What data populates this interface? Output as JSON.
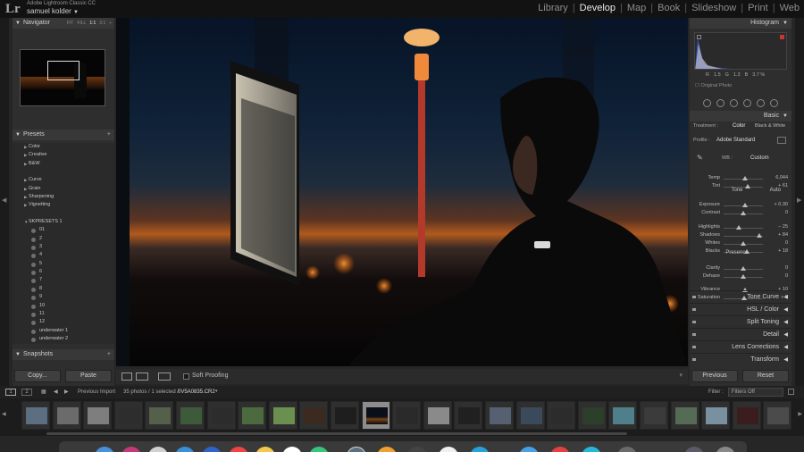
{
  "app": {
    "logo": "Lr",
    "name": "Adobe Lightroom Classic CC",
    "user": "samuel kolder",
    "user_caret": "▼"
  },
  "modules": [
    "Library",
    "Develop",
    "Map",
    "Book",
    "Slideshow",
    "Print",
    "Web"
  ],
  "active_module": "Develop",
  "navigator": {
    "title": "Navigator",
    "options": [
      "FIT",
      "FILL",
      "1:1",
      "3:1"
    ],
    "selected": "1:1",
    "more": "÷"
  },
  "presets": {
    "title": "Presets",
    "groups": [
      "Color",
      "Creative",
      "B&W",
      "Curve",
      "Grain",
      "Sharpening",
      "Vignetting"
    ],
    "user_group": "SKPRESETS 1",
    "user_items": [
      "01",
      "2",
      "3",
      "4",
      "5",
      "6",
      "7",
      "8",
      "9",
      "10",
      "11",
      "12",
      "underwater 1",
      "underwater 2"
    ]
  },
  "snapshots": {
    "title": "Snapshots"
  },
  "left_buttons": {
    "copy": "Copy...",
    "paste": "Paste"
  },
  "toolbar": {
    "soft_proofing": "Soft Proofing"
  },
  "histogram": {
    "title": "Histogram",
    "r": "R",
    "r_val": "1.5",
    "g": "G",
    "g_val": "1.3",
    "b": "B",
    "pct": "3.7 %",
    "original": "Original Photo"
  },
  "basic": {
    "title": "Basic",
    "treatment_label": "Treatment :",
    "treatment_color": "Color",
    "treatment_bw": "Black & White",
    "profile_label": "Profile :",
    "profile_value": "Adobe Standard",
    "wb_label": "WB :",
    "wb_value": "Custom",
    "tone_label": "Tone",
    "auto": "Auto",
    "presence_label": "Presence",
    "sliders": [
      {
        "label": "Temp",
        "value": "6,044",
        "pos": 0.55
      },
      {
        "label": "Tint",
        "value": "+ 61",
        "pos": 0.62
      },
      {
        "label": "Exposure",
        "value": "+ 0.30",
        "pos": 0.55
      },
      {
        "label": "Contrast",
        "value": "0",
        "pos": 0.5
      },
      {
        "label": "Highlights",
        "value": "− 25",
        "pos": 0.38
      },
      {
        "label": "Shadows",
        "value": "+ 84",
        "pos": 0.9
      },
      {
        "label": "Whites",
        "value": "0",
        "pos": 0.5
      },
      {
        "label": "Blacks",
        "value": "+ 18",
        "pos": 0.6
      },
      {
        "label": "Clarity",
        "value": "0",
        "pos": 0.5
      },
      {
        "label": "Dehaze",
        "value": "0",
        "pos": 0.5
      },
      {
        "label": "Vibrance",
        "value": "+ 10",
        "pos": 0.55
      },
      {
        "label": "Saturation",
        "value": "+ 5",
        "pos": 0.52
      }
    ]
  },
  "collapsed_panels": [
    "Tone Curve",
    "HSL / Color",
    "Split Toning",
    "Detail",
    "Lens Corrections",
    "Transform"
  ],
  "right_buttons": {
    "previous": "Previous",
    "reset": "Reset"
  },
  "filmstrip": {
    "screen1": "1",
    "screen2": "2",
    "source": "Previous Import",
    "count": "35 photos / 1 selected /",
    "filename": "0V5A0835.CR2",
    "filter_label": "Filter :",
    "filter_value": "Filters Off"
  },
  "thumb_colors": [
    "#5b6e82",
    "#6b6b6b",
    "#7e7e7e",
    "#2d2d2d",
    "#55604a",
    "#3d5a3a",
    "#2c2c2c",
    "#4b6b3f",
    "#6a8f4e",
    "#3a2a20",
    "#1e1e1e",
    "#1a1a1a",
    "#2a2a2a",
    "#8a8a8a",
    "#202020",
    "#556070",
    "#3a4a5a",
    "#2c2c2c",
    "#2b3f2b",
    "#4e7f8a",
    "#3b3b3b",
    "#556b55",
    "#7890a0",
    "#3a1e1e",
    "#4b4b4b"
  ]
}
